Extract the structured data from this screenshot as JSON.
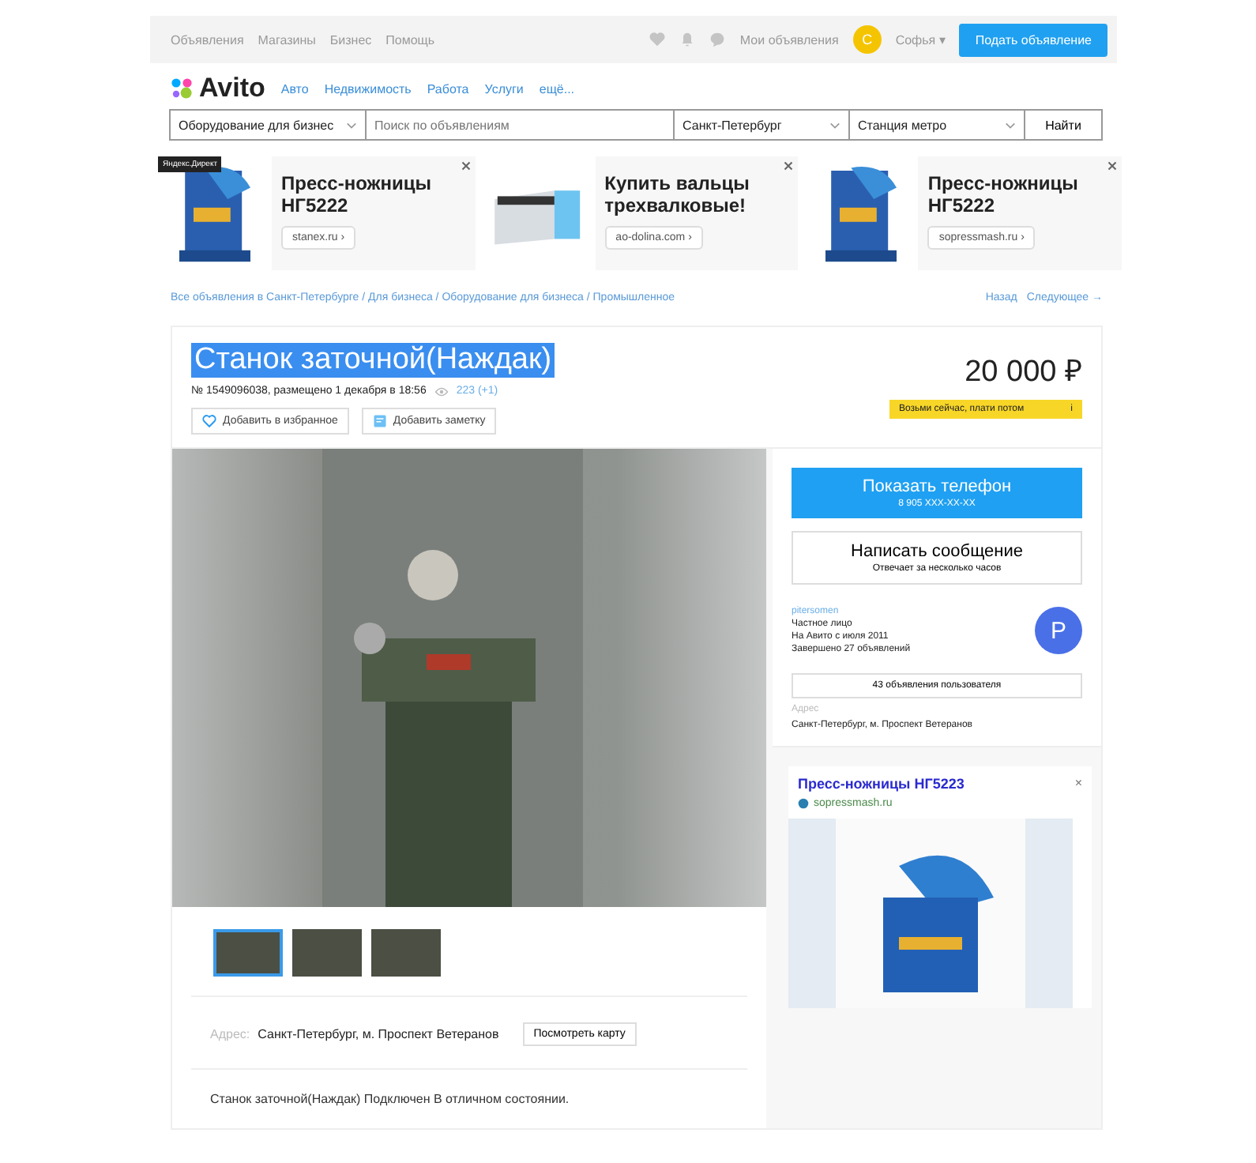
{
  "top_bar": {
    "links": [
      "Объявления",
      "Магазины",
      "Бизнес",
      "Помощь"
    ],
    "my_ads": "Мои объявления",
    "avatar_letter": "С",
    "user": "Софья ▾",
    "post_button": "Подать объявление"
  },
  "logo": "Avito",
  "categories": [
    "Авто",
    "Недвижимость",
    "Работа",
    "Услуги",
    "ещё..."
  ],
  "search": {
    "category": "Оборудование для бизнес",
    "placeholder": "Поиск по объявлениям",
    "city": "Санкт-Петербург",
    "metro": "Станция метро",
    "button": "Найти"
  },
  "ads_badge": "Яндекс.Директ",
  "ads": [
    {
      "title": "Пресс-ножницы НГ5222",
      "site": "stanex.ru ›",
      "kind": "press"
    },
    {
      "title": "Купить вальцы трехвалковые!",
      "site": "ao-dolina.com ›",
      "kind": "rollers"
    },
    {
      "title": "Пресс-ножницы НГ5222",
      "site": "sopressmash.ru ›",
      "kind": "press"
    }
  ],
  "breadcrumbs": "Все объявления в Санкт-Петербурге / Для бизнеса / Оборудование для бизнеса / Промышленное",
  "nav": {
    "back": "Назад",
    "next": "Следующее →"
  },
  "listing": {
    "title": "Станок заточной(Наждак)",
    "title_selected": true,
    "meta": "№ 1549096038, размещено 1 декабря в 18:56",
    "views": "223 (+1)",
    "price": "20 000 ₽",
    "credit": "Возьми сейчас, плати потом",
    "credit_info": "i",
    "favorite": "Добавить в избранное",
    "note": "Добавить заметку"
  },
  "thumbnails": [
    {
      "selected": true
    },
    {
      "selected": false
    },
    {
      "selected": false
    }
  ],
  "contact": {
    "phone_label": "Показать телефон",
    "phone": "8 905 XXX-XX-XX",
    "message_label": "Написать сообщение",
    "message_sub": "Отвечает за несколько часов"
  },
  "seller": {
    "name": "pitersomen",
    "type": "Частное лицо",
    "since": "На Авито с июля 2011",
    "completed": "Завершено 27 объявлений",
    "avatar_letter": "P",
    "all_ads": "43 объявления пользователя",
    "address_label": "Адрес",
    "address": "Санкт-Петербург, м. Проспект Ветеранов"
  },
  "side_ad": {
    "title": "Пресс-ножницы НГ5223",
    "site": "sopressmash.ru",
    "close": "×"
  },
  "address": {
    "label": "Адрес:",
    "value": "Санкт-Петербург, м. Проспект Ветеранов",
    "map_button": "Посмотреть карту"
  },
  "description": "Станок заточной(Наждак) Подключен В отличном состоянии."
}
